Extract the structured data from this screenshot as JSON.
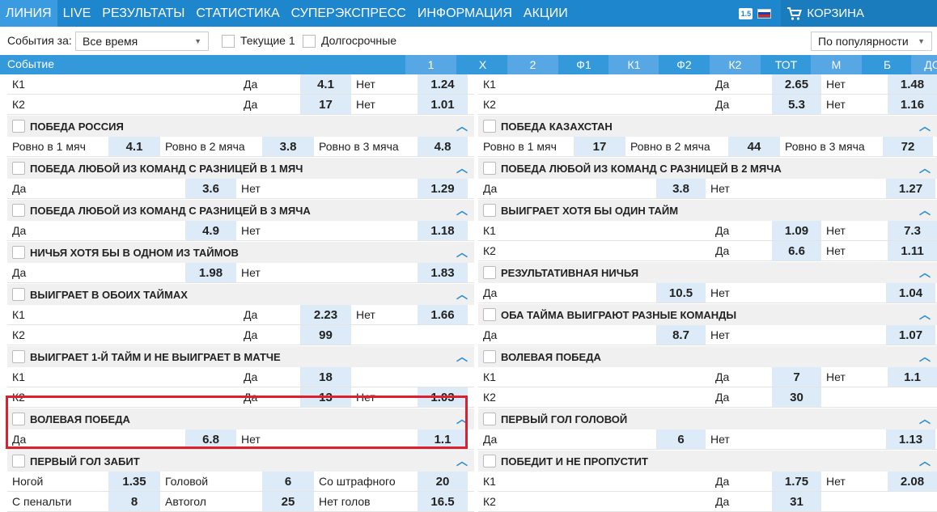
{
  "nav": {
    "items": [
      "ЛИНИЯ",
      "LIVE",
      "РЕЗУЛЬТАТЫ",
      "СТАТИСТИКА",
      "СУПЕРЭКСПРЕСС",
      "ИНФОРМАЦИЯ",
      "АКЦИИ"
    ],
    "version_badge": "1.5",
    "cart_label": "КОРЗИНА"
  },
  "filters": {
    "events_for_label": "События за:",
    "period_value": "Все время",
    "current_label": "Текущие 1",
    "longterm_label": "Долгосрочные",
    "sort_value": "По популярности"
  },
  "columns": {
    "event_label": "Событие",
    "heads": [
      "1",
      "Х",
      "2",
      "Ф1",
      "К1",
      "Ф2",
      "К2",
      "ТОТ",
      "М",
      "Б",
      "ДОП"
    ]
  },
  "left": {
    "top_rows": [
      [
        "К1",
        "Да",
        "4.1",
        "Нет",
        "1.24"
      ],
      [
        "К2",
        "Да",
        "17",
        "Нет",
        "1.01"
      ]
    ],
    "m1": {
      "title": "ПОБЕДА РОССИЯ",
      "row": [
        "Ровно в 1 мяч",
        "4.1",
        "Ровно в 2 мяча",
        "3.8",
        "Ровно в 3 мяча",
        "4.8"
      ]
    },
    "m2": {
      "title": "ПОБЕДА ЛЮБОЙ ИЗ КОМАНД С РАЗНИЦЕЙ В 1 МЯЧ",
      "row": [
        "Да",
        "3.6",
        "Нет",
        "1.29"
      ]
    },
    "m3": {
      "title": "ПОБЕДА ЛЮБОЙ ИЗ КОМАНД С РАЗНИЦЕЙ В 3 МЯЧА",
      "row": [
        "Да",
        "4.9",
        "Нет",
        "1.18"
      ]
    },
    "m4": {
      "title": "НИЧЬЯ ХОТЯ БЫ В ОДНОМ ИЗ ТАЙМОВ",
      "row": [
        "Да",
        "1.98",
        "Нет",
        "1.83"
      ]
    },
    "m5": {
      "title": "ВЫИГРАЕТ В ОБОИХ ТАЙМАХ",
      "rows": [
        [
          "К1",
          "Да",
          "2.23",
          "Нет",
          "1.66"
        ],
        [
          "К2",
          "Да",
          "99",
          "",
          ""
        ]
      ]
    },
    "m6": {
      "title": "ВЫИГРАЕТ 1-Й ТАЙМ И НЕ ВЫИГРАЕТ В МАТЧЕ",
      "rows": [
        [
          "К1",
          "Да",
          "18",
          "",
          ""
        ],
        [
          "К2",
          "Да",
          "13",
          "Нет",
          "1.03"
        ]
      ]
    },
    "m7": {
      "title": "ВОЛЕВАЯ ПОБЕДА",
      "row": [
        "Да",
        "6.8",
        "Нет",
        "1.1"
      ]
    },
    "m8": {
      "title": "ПЕРВЫЙ ГОЛ ЗАБИТ",
      "rows": [
        [
          "Ногой",
          "1.35",
          "Головой",
          "6",
          "Со штрафного",
          "20"
        ],
        [
          "С пенальти",
          "8",
          "Автогол",
          "25",
          "Нет голов",
          "16.5"
        ]
      ]
    }
  },
  "right": {
    "top_rows": [
      [
        "К1",
        "Да",
        "2.65",
        "Нет",
        "1.48"
      ],
      [
        "К2",
        "Да",
        "5.3",
        "Нет",
        "1.16"
      ]
    ],
    "m1": {
      "title": "ПОБЕДА КАЗАХСТАН",
      "row": [
        "Ровно в 1 мяч",
        "17",
        "Ровно в 2 мяча",
        "44",
        "Ровно в 3 мяча",
        "72"
      ]
    },
    "m2": {
      "title": "ПОБЕДА ЛЮБОЙ ИЗ КОМАНД С РАЗНИЦЕЙ В 2 МЯЧА",
      "row": [
        "Да",
        "3.8",
        "Нет",
        "1.27"
      ]
    },
    "m3": {
      "title": "ВЫИГРАЕТ ХОТЯ БЫ ОДИН ТАЙМ",
      "rows": [
        [
          "К1",
          "Да",
          "1.09",
          "Нет",
          "7.3"
        ],
        [
          "К2",
          "Да",
          "6.6",
          "Нет",
          "1.11"
        ]
      ]
    },
    "m4": {
      "title": "РЕЗУЛЬТАТИВНАЯ НИЧЬЯ",
      "row": [
        "Да",
        "10.5",
        "Нет",
        "1.04"
      ]
    },
    "m5": {
      "title": "ОБА ТАЙМА ВЫИГРАЮТ РАЗНЫЕ КОМАНДЫ",
      "row": [
        "Да",
        "8.7",
        "Нет",
        "1.07"
      ]
    },
    "m6": {
      "title": "ВОЛЕВАЯ ПОБЕДА",
      "rows": [
        [
          "К1",
          "Да",
          "7",
          "Нет",
          "1.1"
        ],
        [
          "К2",
          "Да",
          "30",
          "",
          ""
        ]
      ]
    },
    "m7": {
      "title": "ПЕРВЫЙ ГОЛ ГОЛОВОЙ",
      "row": [
        "Да",
        "6",
        "Нет",
        "1.13"
      ]
    },
    "m8": {
      "title": "ПОБЕДИТ И НЕ ПРОПУСТИТ",
      "rows": [
        [
          "К1",
          "Да",
          "1.75",
          "Нет",
          "2.08"
        ],
        [
          "К2",
          "Да",
          "31",
          "",
          ""
        ]
      ]
    }
  },
  "colors": {
    "nav": "#1e86cd",
    "header": "#3399db",
    "odds_bg": "#dcebf7",
    "highlight": "#e01f2c"
  }
}
